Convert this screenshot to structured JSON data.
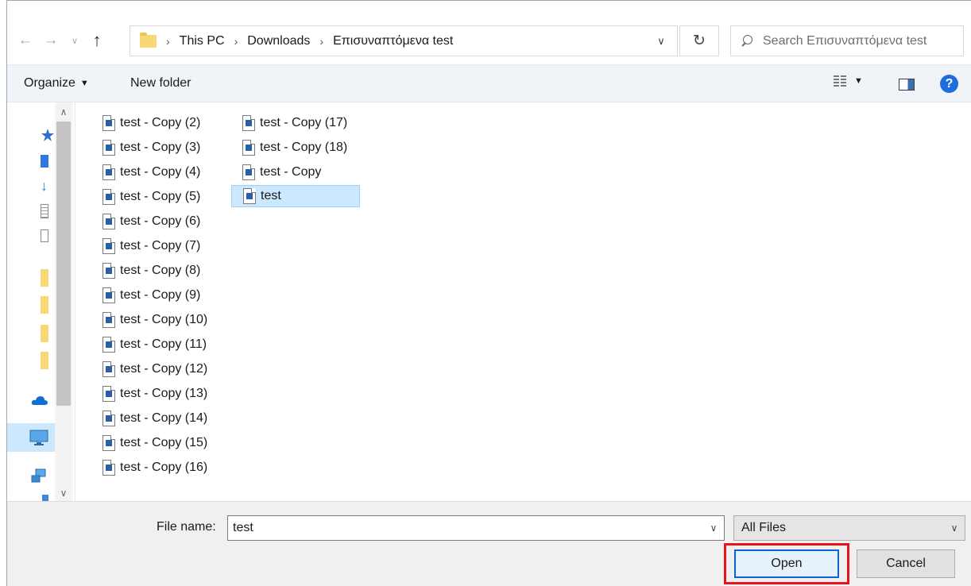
{
  "address": {
    "breadcrumb": [
      "This PC",
      "Downloads",
      "Επισυναπτόμενα test"
    ]
  },
  "search": {
    "placeholder": "Search Επισυναπτόμενα test"
  },
  "toolbar": {
    "organize_label": "Organize",
    "new_folder_label": "New folder",
    "help_label": "?"
  },
  "files": {
    "column1": [
      "test - Copy (2)",
      "test - Copy (3)",
      "test - Copy (4)",
      "test - Copy (5)",
      "test - Copy (6)",
      "test - Copy (7)",
      "test - Copy (8)",
      "test - Copy (9)",
      "test - Copy (10)",
      "test - Copy (11)",
      "test - Copy (12)",
      "test - Copy (13)",
      "test - Copy (14)",
      "test - Copy (15)",
      "test - Copy (16)"
    ],
    "column2": [
      "test - Copy (17)",
      "test - Copy (18)",
      "test - Copy",
      "test"
    ],
    "selected": "test"
  },
  "footer": {
    "filename_label": "File name:",
    "filename_value": "test",
    "filetype_value": "All Files",
    "open_label": "Open",
    "cancel_label": "Cancel"
  },
  "colors": {
    "accent": "#0a64d6",
    "selection": "#cce8ff",
    "highlight": "#e8141c"
  }
}
